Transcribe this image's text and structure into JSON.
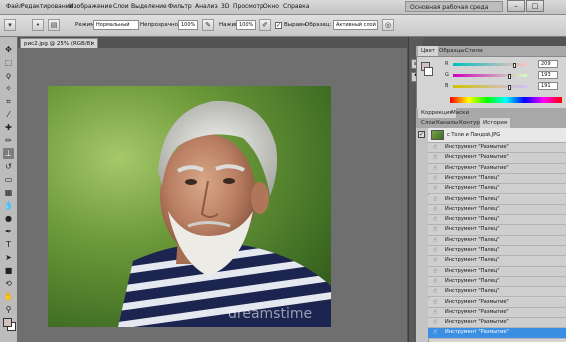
{
  "app": {
    "menu": [
      "Файл",
      "Редактирование",
      "Изображение",
      "Слои",
      "Выделение",
      "Фильтр",
      "Анализ",
      "3D",
      "Просмотр",
      "Окно",
      "Справка"
    ],
    "workspace": "Основная рабочая среда",
    "window_buttons": [
      "–",
      "□"
    ]
  },
  "options_bar": {
    "mode_label": "Режим:",
    "mode_value": "Нормальный",
    "opacity_label": "Непрозрачность:",
    "opacity_value": "100%",
    "pressure_label": "Нажим:",
    "pressure_value": "100%",
    "sample_all_label": "Выравн.",
    "sample_label": "Образец:",
    "sample_value": "Активный слой"
  },
  "document": {
    "tab_title": "рис2.jpg @ 25% (RGB/8)",
    "close": "×",
    "watermark": "dreamstime"
  },
  "color_panel": {
    "tabs": [
      "Цвет",
      "Образцы",
      "Стили"
    ],
    "channels": [
      {
        "label": "R",
        "value": "209",
        "fraction": 0.82
      },
      {
        "label": "G",
        "value": "193",
        "fraction": 0.76
      },
      {
        "label": "B",
        "value": "191",
        "fraction": 0.75
      }
    ],
    "swatch_color": "#d1c1bf"
  },
  "adjust_panel": {
    "tabs": [
      "Коррекция",
      "Маски"
    ]
  },
  "layers_panel": {
    "tabs": [
      "Слои",
      "Каналы",
      "Контуры",
      "История"
    ],
    "snapshot": "с Толи и Пандой.JPG",
    "history": [
      "Инструмент \"Размытие\"",
      "Инструмент \"Размытие\"",
      "Инструмент \"Размытие\"",
      "Инструмент \"Палец\"",
      "Инструмент \"Палец\"",
      "Инструмент \"Палец\"",
      "Инструмент \"Палец\"",
      "Инструмент \"Палец\"",
      "Инструмент \"Палец\"",
      "Инструмент \"Палец\"",
      "Инструмент \"Палец\"",
      "Инструмент \"Палец\"",
      "Инструмент \"Палец\"",
      "Инструмент \"Палец\"",
      "Инструмент \"Палец\"",
      "Инструмент \"Размытие\"",
      "Инструмент \"Размытие\"",
      "Инструмент \"Размытие\"",
      "Инструмент \"Размытие\""
    ],
    "selected_index": 18
  },
  "colors": {
    "accent": "#3a8fe3",
    "foreground": "#d1c1bf",
    "background": "#ffffff"
  }
}
